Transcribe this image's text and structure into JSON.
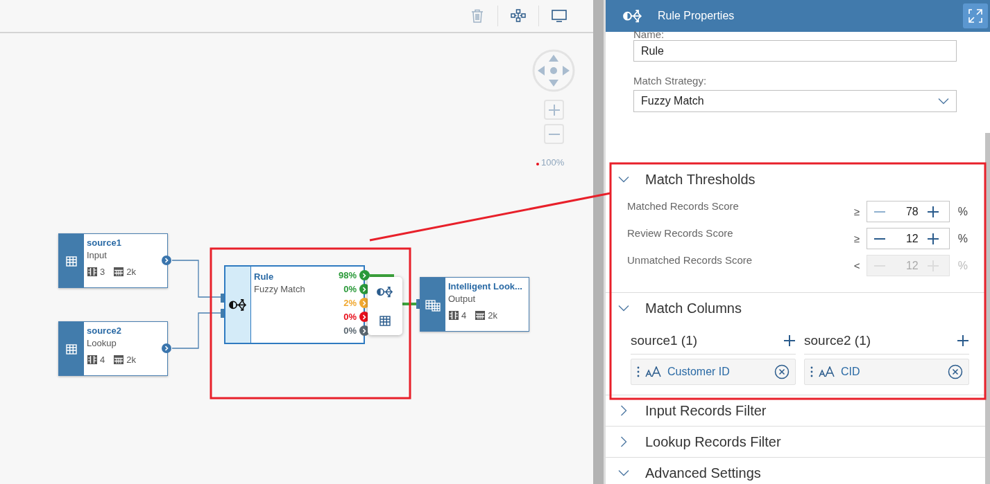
{
  "toolbar": {
    "buttons": [
      {
        "kind": "delete",
        "disabled": true
      },
      {
        "kind": "layout",
        "disabled": false
      },
      {
        "kind": "monitor",
        "disabled": false
      }
    ]
  },
  "zoom": {
    "level_text": "100%"
  },
  "nodes": [
    {
      "title": "source1",
      "subtitle": "Input",
      "columns": "3",
      "rows": "2k"
    },
    {
      "title": "source2",
      "subtitle": "Lookup",
      "columns": "4",
      "rows": "2k"
    },
    {
      "title": "Intelligent Look...",
      "subtitle": "Output",
      "columns": "4",
      "rows": "2k"
    }
  ],
  "rule_node": {
    "title": "Rule",
    "subtitle": "Fuzzy Match",
    "selected": true,
    "outputs": [
      {
        "text": "98%",
        "color": "#2b9a3a"
      },
      {
        "text": "0%",
        "color": "#2b9a3a"
      },
      {
        "text": "2%",
        "color": "#f0a830"
      },
      {
        "text": "0%",
        "color": "#e8101c"
      },
      {
        "text": "0%",
        "color": "#5b6770"
      }
    ]
  },
  "panel": {
    "title": "Rule Properties",
    "name_label": "Name:",
    "name_value": "Rule",
    "strategy_label": "Match Strategy:",
    "strategy_value": "Fuzzy Match"
  },
  "sections": [
    {
      "kind": "thresholds",
      "title": "Match Thresholds",
      "expanded": true,
      "rows": [
        {
          "label": "Matched Records Score",
          "operator": "≥",
          "value": "78",
          "unit": "%",
          "disabled": false,
          "decrease_disabled": true
        },
        {
          "label": "Review Records Score",
          "operator": "≥",
          "value": "12",
          "unit": "%",
          "disabled": false,
          "decrease_disabled": false
        },
        {
          "label": "Unmatched Records Score",
          "operator": "<",
          "value": "12",
          "unit": "%",
          "disabled": true
        }
      ]
    },
    {
      "kind": "columns",
      "title": "Match Columns",
      "expanded": true,
      "columns": [
        {
          "header": "source1 (1)",
          "items": [
            "Customer ID"
          ]
        },
        {
          "header": "source2 (1)",
          "items": [
            "CID"
          ]
        }
      ]
    },
    {
      "kind": "plain",
      "title": "Input Records Filter",
      "expanded": false
    },
    {
      "kind": "plain",
      "title": "Lookup Records Filter",
      "expanded": false
    },
    {
      "kind": "plain",
      "title": "Advanced Settings",
      "expanded": true
    }
  ]
}
